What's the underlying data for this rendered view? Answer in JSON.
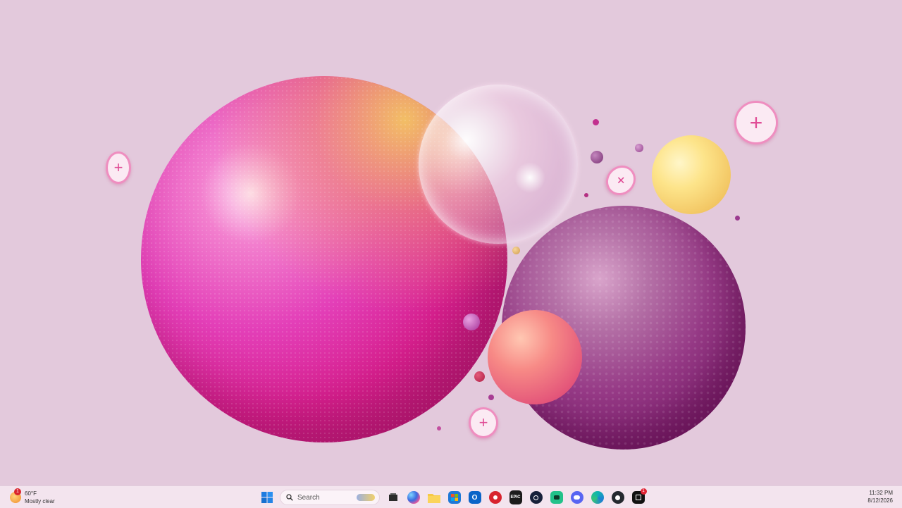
{
  "desktop": {
    "wallpaper": "abstract spheres",
    "colors": {
      "background": "#e3c9dc",
      "magenta": "#d61f8d",
      "plum": "#7c1e6e",
      "yellow": "#fde48a",
      "coral": "#f78a86"
    }
  },
  "taskbar": {
    "weather": {
      "temperature": "60°F",
      "condition": "Mostly clear",
      "badge": "1",
      "icon": "weather-sun-icon"
    },
    "start": {
      "icon": "windows-start-icon"
    },
    "search": {
      "placeholder": "Search",
      "icon": "search-icon"
    },
    "pinned_apps": [
      {
        "name": "Task View",
        "icon": "task-view-icon"
      },
      {
        "name": "Copilot",
        "icon": "copilot-icon"
      },
      {
        "name": "File Explorer",
        "icon": "file-explorer-icon"
      },
      {
        "name": "Microsoft Store",
        "icon": "store-icon"
      },
      {
        "name": "Outlook",
        "icon": "outlook-icon"
      },
      {
        "name": "Red app",
        "icon": "red-app-icon"
      },
      {
        "name": "Epic Games",
        "icon": "epic-games-icon",
        "label": "EPIC"
      },
      {
        "name": "Steam",
        "icon": "steam-icon"
      },
      {
        "name": "Green app",
        "icon": "green-app-icon"
      },
      {
        "name": "Discord",
        "icon": "discord-icon"
      },
      {
        "name": "Edge",
        "icon": "edge-icon"
      },
      {
        "name": "GitHub",
        "icon": "github-icon"
      },
      {
        "name": "Black app",
        "icon": "black-app-icon",
        "badge": "1"
      }
    ],
    "clock": {
      "time": "11:32 PM",
      "date": "8/12/2026"
    }
  }
}
